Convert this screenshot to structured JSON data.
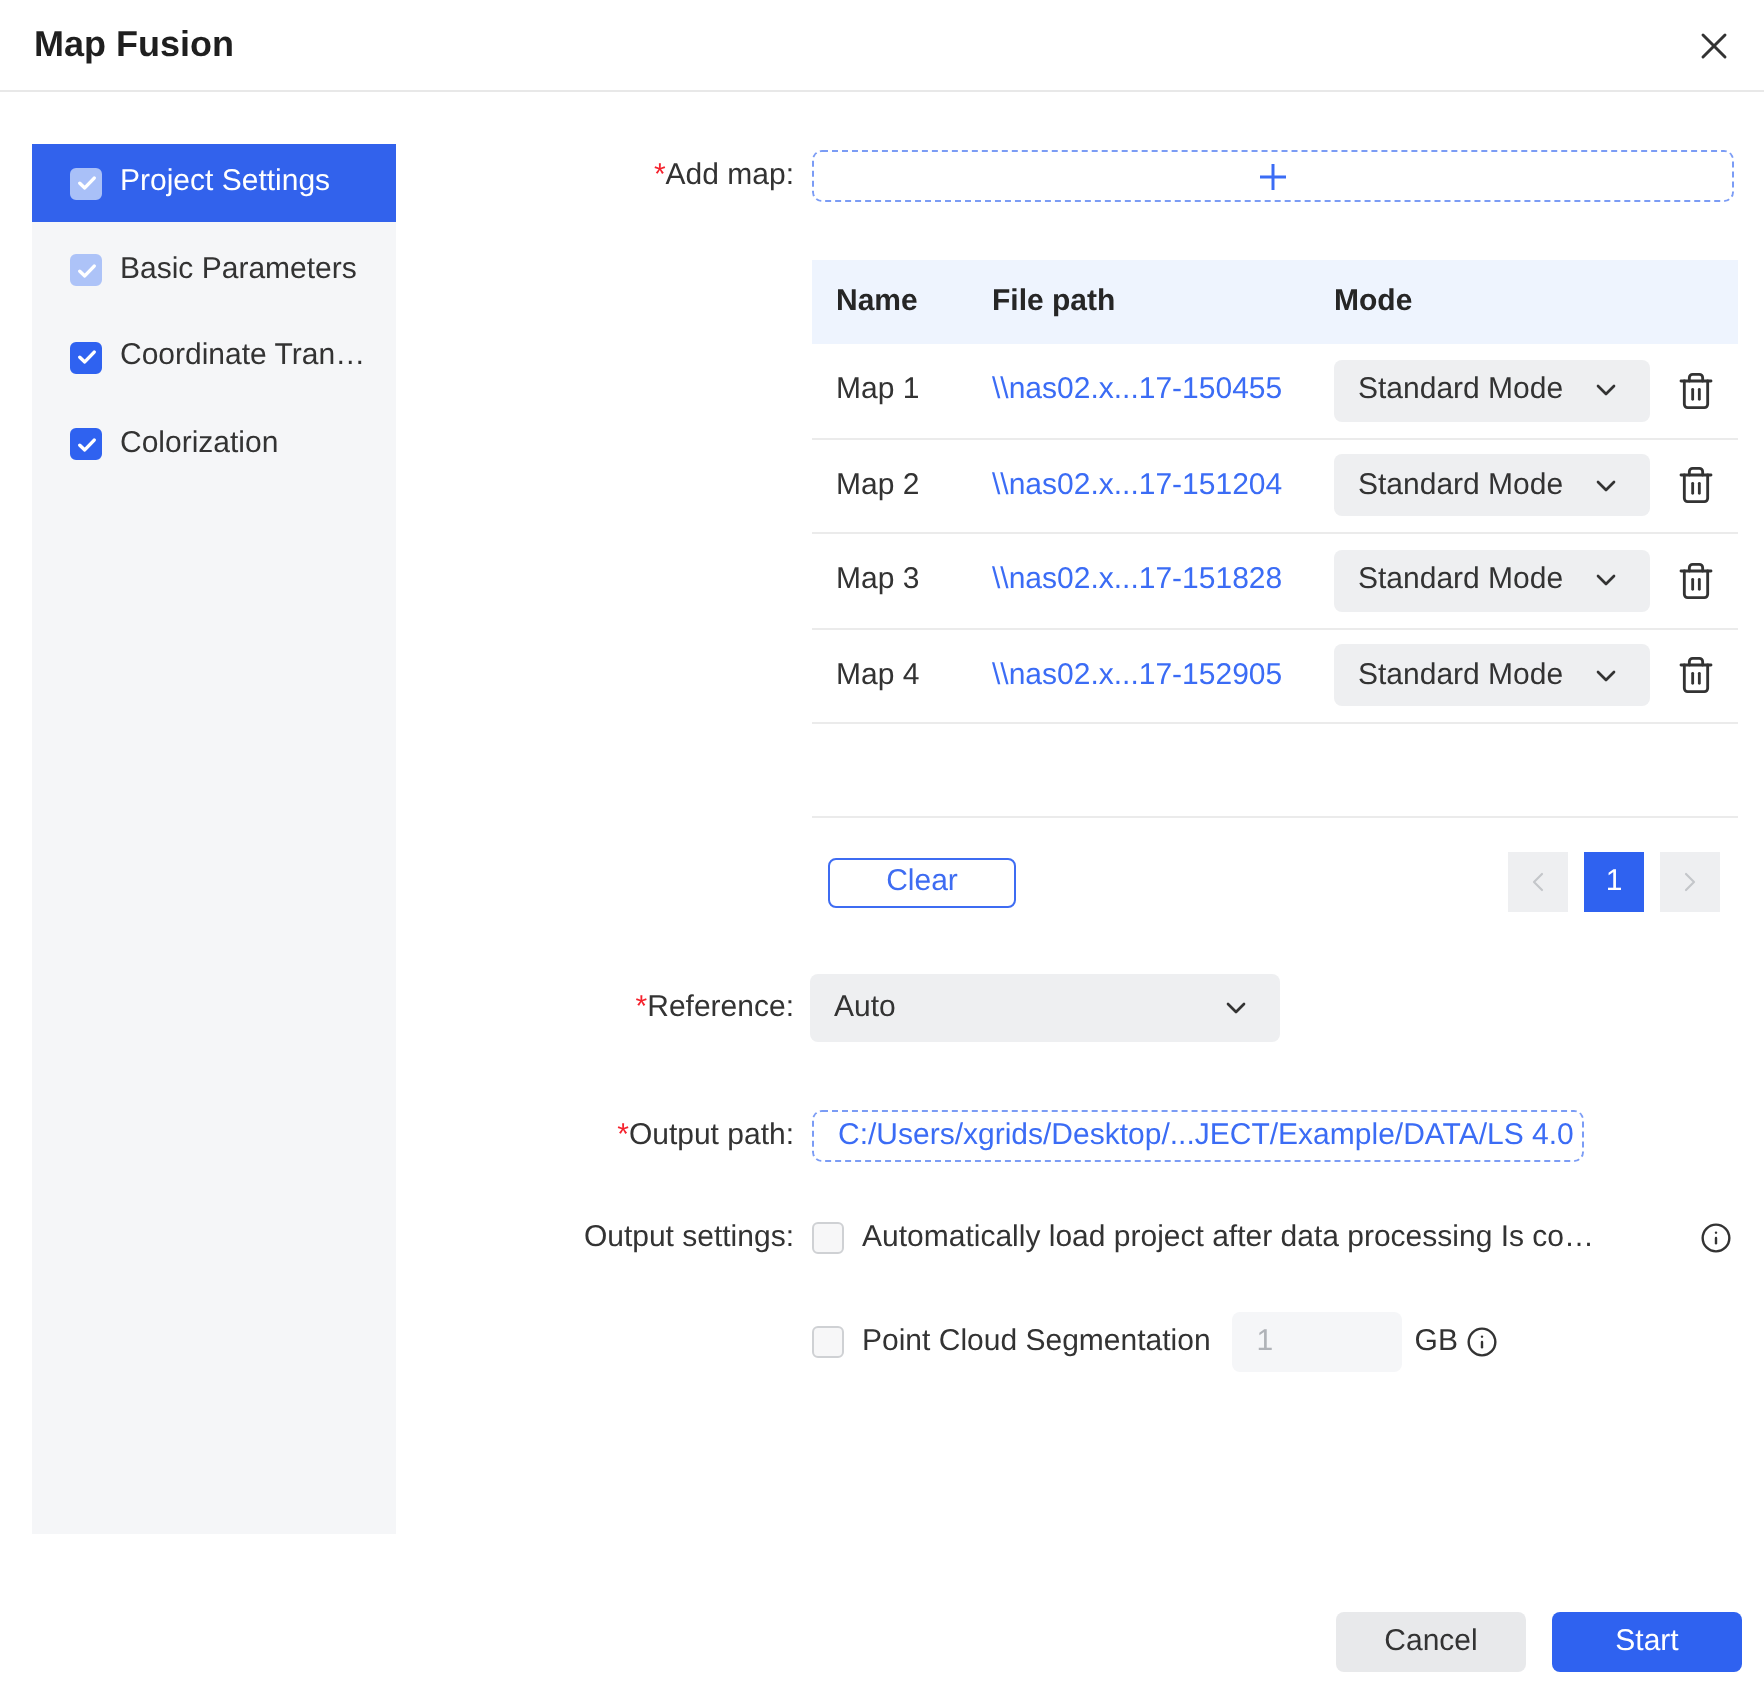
{
  "dialog": {
    "title": "Map Fusion"
  },
  "sidebar": {
    "items": [
      {
        "label": "Project Settings",
        "selected": true,
        "checked": true,
        "disabled": true
      },
      {
        "label": "Basic Parameters",
        "selected": false,
        "checked": true,
        "disabled": true
      },
      {
        "label": "Coordinate Tran…",
        "selected": false,
        "checked": true,
        "disabled": false
      },
      {
        "label": "Colorization",
        "selected": false,
        "checked": true,
        "disabled": false
      }
    ]
  },
  "add_map": {
    "required_mark": "*",
    "label": "Add map:"
  },
  "map_table": {
    "columns": [
      "Name",
      "File path",
      "Mode"
    ],
    "rows": [
      {
        "name": "Map 1",
        "file_path": "\\\\nas02.x...17-150455",
        "mode": "Standard Mode"
      },
      {
        "name": "Map 2",
        "file_path": "\\\\nas02.x...17-151204",
        "mode": "Standard Mode"
      },
      {
        "name": "Map 3",
        "file_path": "\\\\nas02.x...17-151828",
        "mode": "Standard Mode"
      },
      {
        "name": "Map 4",
        "file_path": "\\\\nas02.x...17-152905",
        "mode": "Standard Mode"
      }
    ]
  },
  "clear_button": "Clear",
  "pagination": {
    "prev": {
      "disabled": true
    },
    "pages": [
      {
        "label": "1",
        "selected": true
      }
    ],
    "next": {
      "disabled": true
    }
  },
  "reference": {
    "required_mark": "*",
    "label": "Reference:",
    "value": "Auto"
  },
  "output_path": {
    "required_mark": "*",
    "label": "Output path:",
    "value": "C:/Users/xgrids/Desktop/...JECT/Example/DATA/LS 4.0"
  },
  "output_settings": {
    "label": "Output settings:",
    "options": [
      {
        "kind": "toggle",
        "label": "Automatically load project after data processing Is co…",
        "checked": false
      },
      {
        "kind": "segmentation",
        "label": "Point Cloud Segmentation",
        "checked": false,
        "value": "1",
        "disabled": true,
        "unit": "GB"
      }
    ]
  },
  "footer": {
    "buttons": [
      {
        "label": "Cancel",
        "kind": "secondary"
      },
      {
        "label": "Start",
        "kind": "primary"
      }
    ]
  }
}
